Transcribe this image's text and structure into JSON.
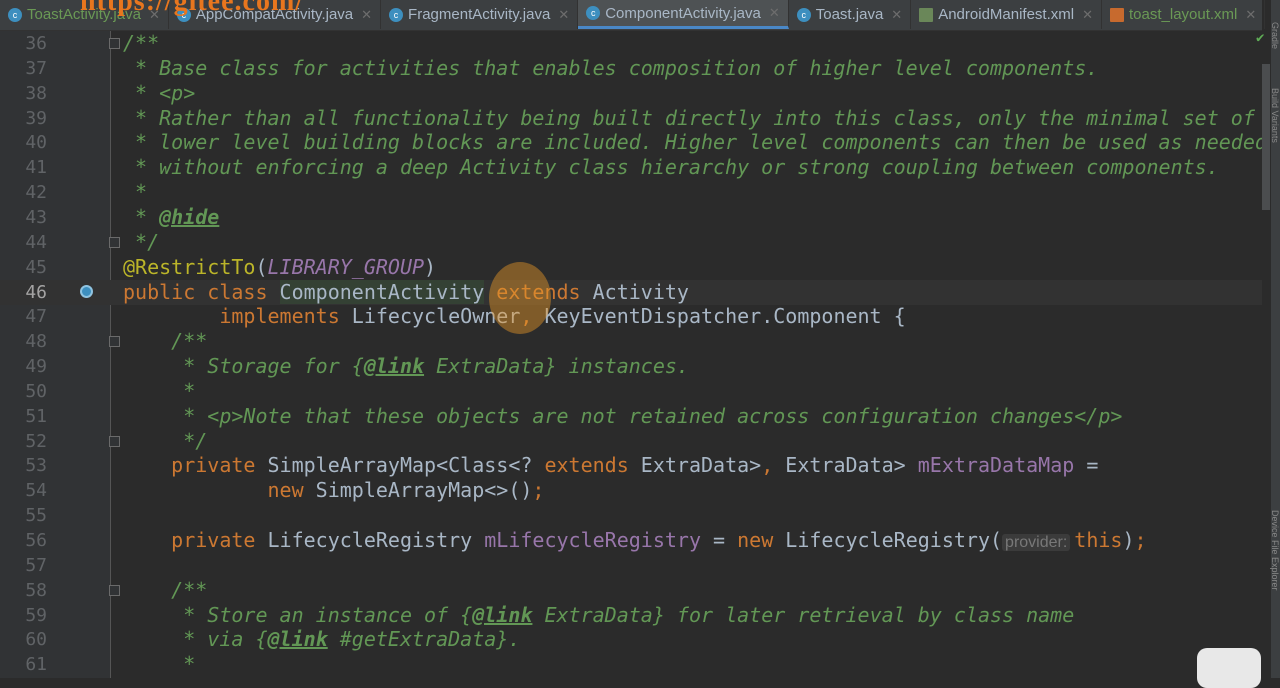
{
  "watermark": "https://gitee.com/",
  "tabs": [
    {
      "label": "ToastActivity.java",
      "icon": "java-class-icon",
      "active": false
    },
    {
      "label": "AppCompatActivity.java",
      "icon": "java-class-locked-icon",
      "active": false
    },
    {
      "label": "FragmentActivity.java",
      "icon": "java-class-locked-icon",
      "active": false
    },
    {
      "label": "ComponentActivity.java",
      "icon": "java-class-locked-icon",
      "active": true
    },
    {
      "label": "Toast.java",
      "icon": "java-class-icon",
      "active": false
    },
    {
      "label": "AndroidManifest.xml",
      "icon": "manifest-icon",
      "active": false
    },
    {
      "label": "toast_layout.xml",
      "icon": "xml-layout-icon",
      "active": false
    }
  ],
  "right_tool_windows": [
    "Gradle",
    "Build Variants",
    "Device File Explorer"
  ],
  "colors": {
    "background": "#2b2b2b",
    "comment": "#629755",
    "keyword": "#cc7832",
    "annotation": "#bbb529",
    "field": "#9876aa",
    "text": "#a9b7c6"
  },
  "current_line": 46,
  "lines": [
    {
      "n": "36",
      "fold": true,
      "t": [
        [
          "/**",
          "c"
        ]
      ]
    },
    {
      "n": "37",
      "t": [
        [
          " * Base class for activities that enables composition of higher level components.",
          "c"
        ]
      ]
    },
    {
      "n": "38",
      "t": [
        [
          " * <p>",
          "c"
        ]
      ]
    },
    {
      "n": "39",
      "t": [
        [
          " * Rather than all functionality being built directly into this class, only the minimal set of",
          "c"
        ]
      ]
    },
    {
      "n": "40",
      "t": [
        [
          " * lower level building blocks are included. Higher level components can then be used as needed",
          "c"
        ]
      ]
    },
    {
      "n": "41",
      "t": [
        [
          " * without enforcing a deep Activity class hierarchy or strong coupling between components.",
          "c"
        ]
      ]
    },
    {
      "n": "42",
      "t": [
        [
          " *",
          "c"
        ]
      ]
    },
    {
      "n": "43",
      "t": [
        [
          " * ",
          "c"
        ],
        [
          "@hide",
          "cu"
        ]
      ]
    },
    {
      "n": "44",
      "fold": true,
      "t": [
        [
          " */",
          "c"
        ]
      ]
    },
    {
      "n": "45",
      "t": [
        [
          "@RestrictTo",
          "a"
        ],
        [
          "(",
          ""
        ],
        [
          "LIBRARY_GROUP",
          "pi"
        ],
        [
          ")",
          ""
        ]
      ]
    },
    {
      "n": "46",
      "t": [
        [
          "public class ",
          "k"
        ],
        [
          "ComponentActivity",
          "hl"
        ],
        [
          " extends ",
          "k"
        ],
        [
          "Activity",
          ""
        ]
      ]
    },
    {
      "n": "47",
      "t": [
        [
          "        ",
          ""
        ],
        [
          "implements ",
          "k"
        ],
        [
          "LifecycleOwner",
          ""
        ],
        [
          ", ",
          "k"
        ],
        [
          "KeyEventDispatcher.Component {",
          ""
        ]
      ]
    },
    {
      "n": "48",
      "fold": true,
      "t": [
        [
          "    /**",
          "c"
        ]
      ]
    },
    {
      "n": "49",
      "t": [
        [
          "     * Storage for {",
          "c"
        ],
        [
          "@link",
          "cu"
        ],
        [
          " ExtraData} instances.",
          "c"
        ]
      ]
    },
    {
      "n": "50",
      "t": [
        [
          "     *",
          "c"
        ]
      ]
    },
    {
      "n": "51",
      "t": [
        [
          "     * <p>Note that these objects are not retained across configuration changes</p>",
          "c"
        ]
      ]
    },
    {
      "n": "52",
      "fold": true,
      "t": [
        [
          "     */",
          "c"
        ]
      ]
    },
    {
      "n": "53",
      "t": [
        [
          "    ",
          ""
        ],
        [
          "private ",
          "k"
        ],
        [
          "SimpleArrayMap<Class<? ",
          ""
        ],
        [
          "extends ",
          "k"
        ],
        [
          "ExtraData>",
          ""
        ],
        [
          ", ",
          "k"
        ],
        [
          "ExtraData> ",
          ""
        ],
        [
          "mExtraDataMap",
          "p"
        ],
        [
          " =",
          ""
        ]
      ]
    },
    {
      "n": "54",
      "t": [
        [
          "            ",
          ""
        ],
        [
          "new ",
          "k"
        ],
        [
          "SimpleArrayMap<>()",
          ""
        ],
        [
          ";",
          "k"
        ]
      ]
    },
    {
      "n": "55",
      "t": []
    },
    {
      "n": "56",
      "t": [
        [
          "    ",
          ""
        ],
        [
          "private ",
          "k"
        ],
        [
          "LifecycleRegistry ",
          ""
        ],
        [
          "mLifecycleRegistry",
          "p"
        ],
        [
          " = ",
          ""
        ],
        [
          "new ",
          "k"
        ],
        [
          "LifecycleRegistry(",
          ""
        ],
        [
          "provider:",
          "hint"
        ],
        [
          "this",
          "k"
        ],
        [
          ")",
          ""
        ],
        [
          ";",
          "k"
        ]
      ]
    },
    {
      "n": "57",
      "t": []
    },
    {
      "n": "58",
      "fold": true,
      "t": [
        [
          "    /**",
          "c"
        ]
      ]
    },
    {
      "n": "59",
      "t": [
        [
          "     * Store an instance of {",
          "c"
        ],
        [
          "@link",
          "cu"
        ],
        [
          " ExtraData} for later retrieval by class name",
          "c"
        ]
      ]
    },
    {
      "n": "60",
      "t": [
        [
          "     * via {",
          "c"
        ],
        [
          "@link",
          "cu"
        ],
        [
          " #getExtraData}.",
          "c"
        ]
      ]
    },
    {
      "n": "61",
      "t": [
        [
          "     *",
          "c"
        ]
      ]
    }
  ]
}
